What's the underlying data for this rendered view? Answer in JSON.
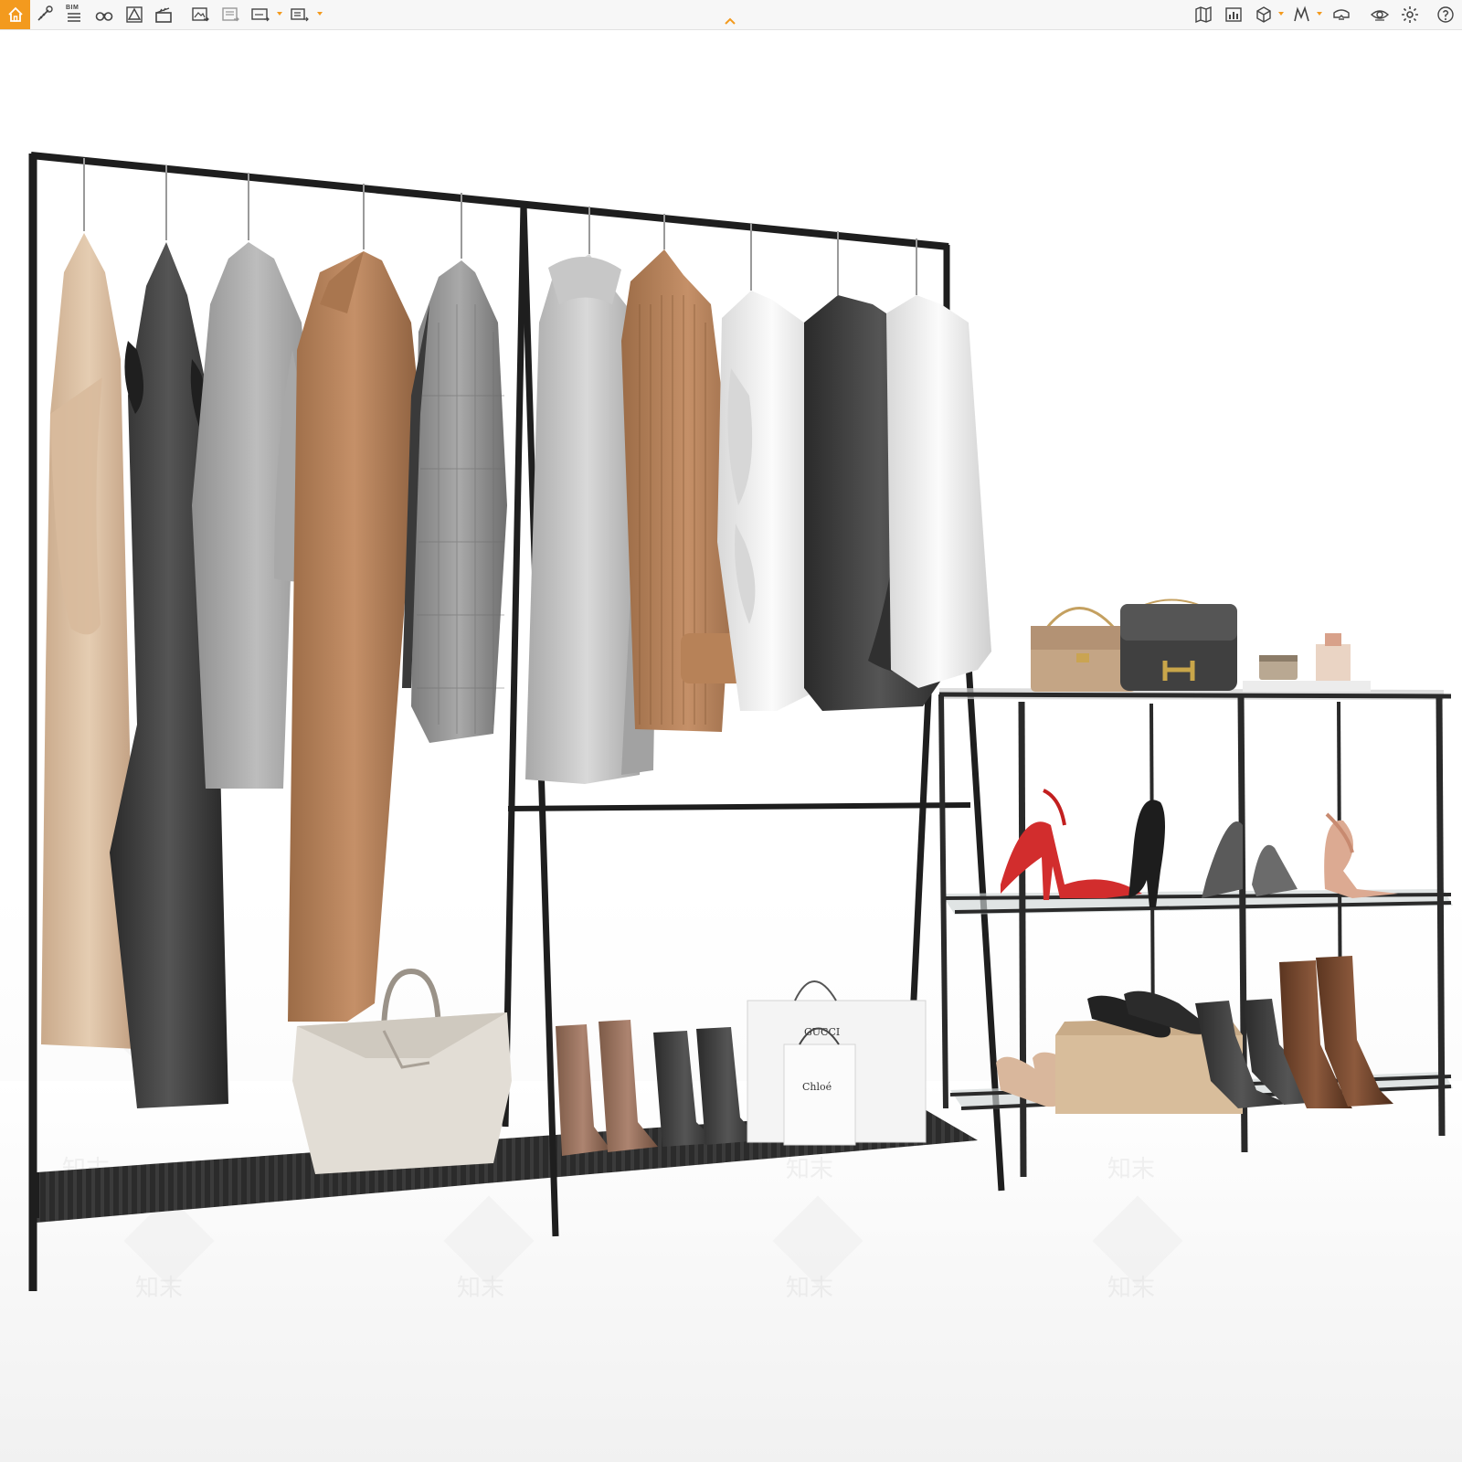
{
  "toolbar": {
    "bim_label": "BIM",
    "left_tools": [
      {
        "name": "home-button"
      },
      {
        "name": "measure-tool"
      },
      {
        "name": "bim-tool"
      },
      {
        "name": "walkthrough-tool"
      },
      {
        "name": "section-tool"
      },
      {
        "name": "clapperboard-tool"
      },
      {
        "name": "export-image-tool"
      },
      {
        "name": "export-layer-tool"
      },
      {
        "name": "export-360-tool"
      },
      {
        "name": "export-exe-tool"
      }
    ],
    "right_tools": [
      {
        "name": "map-tool"
      },
      {
        "name": "chart-tool"
      },
      {
        "name": "cube-tool"
      },
      {
        "name": "path-tool"
      },
      {
        "name": "vr-tool"
      },
      {
        "name": "eye-tool"
      },
      {
        "name": "settings-tool"
      },
      {
        "name": "help-tool"
      }
    ],
    "accent_color": "#f39a1e"
  },
  "viewport": {
    "watermark_text": "知末",
    "bag_brands": {
      "gucci": "GUCCI",
      "chloe": "Chloé"
    }
  }
}
